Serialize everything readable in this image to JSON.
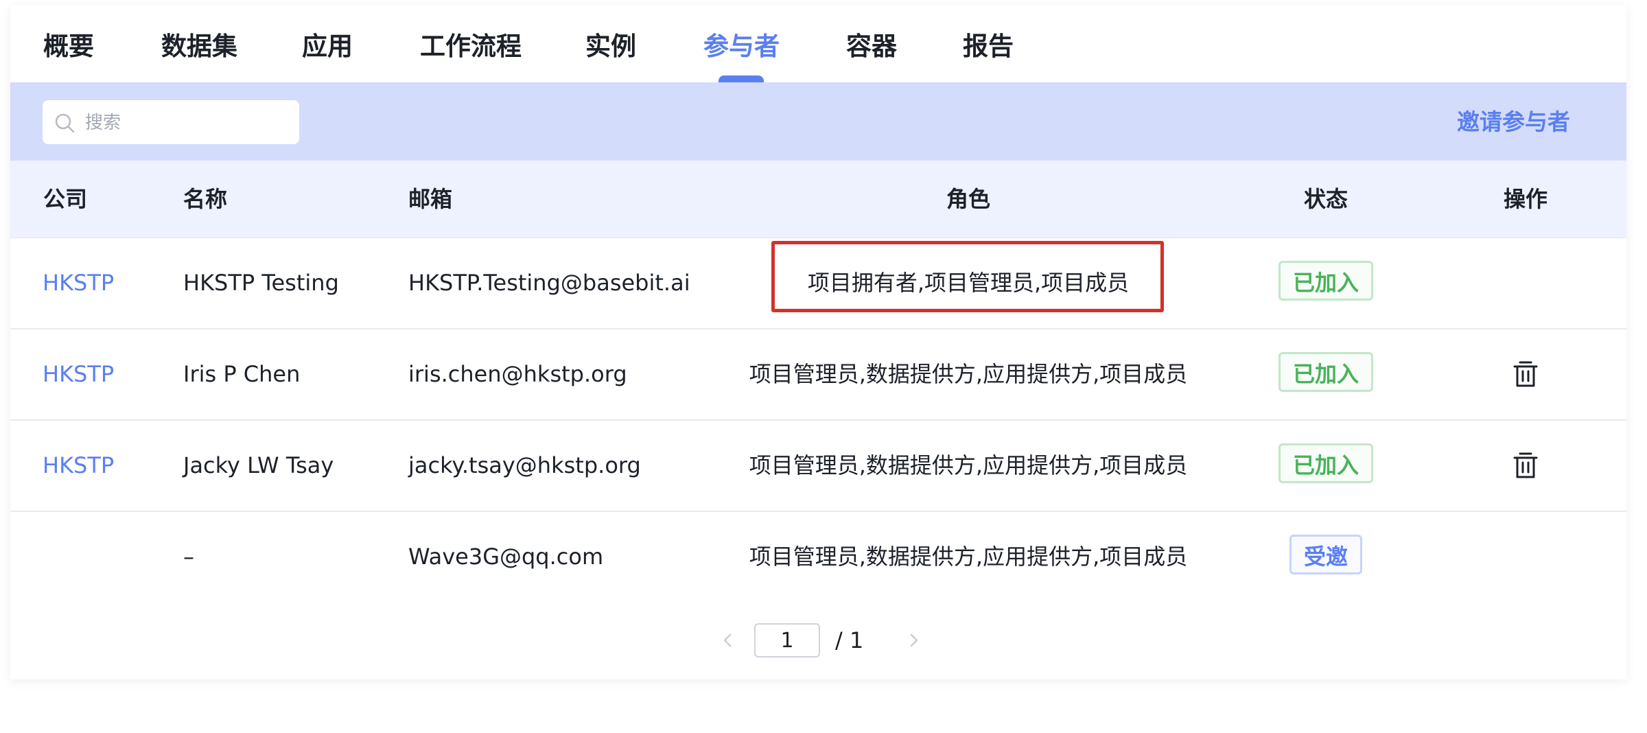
{
  "tabs": [
    {
      "label": "概要"
    },
    {
      "label": "数据集"
    },
    {
      "label": "应用"
    },
    {
      "label": "工作流程"
    },
    {
      "label": "实例"
    },
    {
      "label": "参与者"
    },
    {
      "label": "容器"
    },
    {
      "label": "报告"
    }
  ],
  "active_tab": "参与者",
  "toolbar": {
    "search_placeholder": "搜索",
    "invite_label": "邀请参与者"
  },
  "table": {
    "columns": [
      "公司",
      "名称",
      "邮箱",
      "角色",
      "状态",
      "操作"
    ],
    "rows": [
      {
        "company": "HKSTP",
        "name": "HKSTP Testing",
        "email": "HKSTP.Testing@basebit.ai",
        "roles": "项目拥有者,项目管理员,项目成员",
        "status": "已加入",
        "status_type": "joined",
        "highlighted": true,
        "deletable": false
      },
      {
        "company": "HKSTP",
        "name": "Iris P Chen",
        "email": "iris.chen@hkstp.org",
        "roles": "项目管理员,数据提供方,应用提供方,项目成员",
        "status": "已加入",
        "status_type": "joined",
        "deletable": true
      },
      {
        "company": "HKSTP",
        "name": "Jacky LW Tsay",
        "email": "jacky.tsay@hkstp.org",
        "roles": "项目管理员,数据提供方,应用提供方,项目成员",
        "status": "已加入",
        "status_type": "joined",
        "deletable": true
      },
      {
        "company": "",
        "name": "–",
        "email": "Wave3G@qq.com",
        "roles": "项目管理员,数据提供方,应用提供方,项目成员",
        "status": "受邀",
        "status_type": "invited",
        "deletable": false
      }
    ]
  },
  "pagination": {
    "current_page": "1",
    "total_pages": "/ 1",
    "prev_icon": "chevron-left-icon",
    "next_icon": "chevron-right-icon"
  },
  "icons": {
    "search": "search-icon",
    "delete": "trash-icon"
  },
  "colors": {
    "accent": "#5b7ff0",
    "toolbar_bg": "#d3dcfb",
    "header_bg": "#eef2fe",
    "joined": "#49b35a",
    "highlight_border": "#d4312a"
  }
}
